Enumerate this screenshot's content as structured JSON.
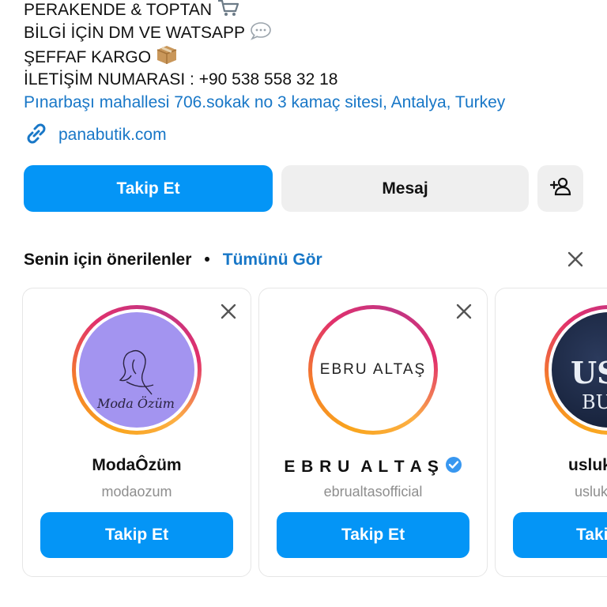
{
  "bio": {
    "lines": [
      "PERAKENDE & TOPTAN",
      "BİLGİ İÇİN DM VE WATSAPP",
      "ŞEFFAF KARGO",
      "İLETİŞİM NUMARASI :  +90 538 558 32 18"
    ],
    "address": "Pınarbaşı mahallesi 706.sokak no 3 kamaç sitesi, Antalya, Turkey",
    "website": "panabutik.com",
    "emoji_icons": [
      "shopping-cart-icon",
      "speech-bubble-icon",
      "package-icon"
    ]
  },
  "actions": {
    "follow_label": "Takip Et",
    "message_label": "Mesaj"
  },
  "suggestions": {
    "title": "Senin için önerilenler",
    "separator": "•",
    "see_all": "Tümünü Gör",
    "cards": [
      {
        "name": "ModaÔzüm",
        "handle": "modaozum",
        "button": "Takip Et",
        "avatar_text": "Moda Özüm"
      },
      {
        "name": "E B R U  A L T A Ş",
        "handle": "ebrualtasofficial",
        "button": "Takip Et",
        "avatar_text": "EBRU ALTAŞ",
        "verified": true
      },
      {
        "name": "usluk",
        "handle": "usluk",
        "button": "Takip Et",
        "avatar_text": "US",
        "avatar_subtext": "BU"
      }
    ]
  },
  "colors": {
    "primary": "#0495f6",
    "link": "#1877c7",
    "secondary_bg": "#efefef",
    "muted": "#8e8e8e"
  }
}
